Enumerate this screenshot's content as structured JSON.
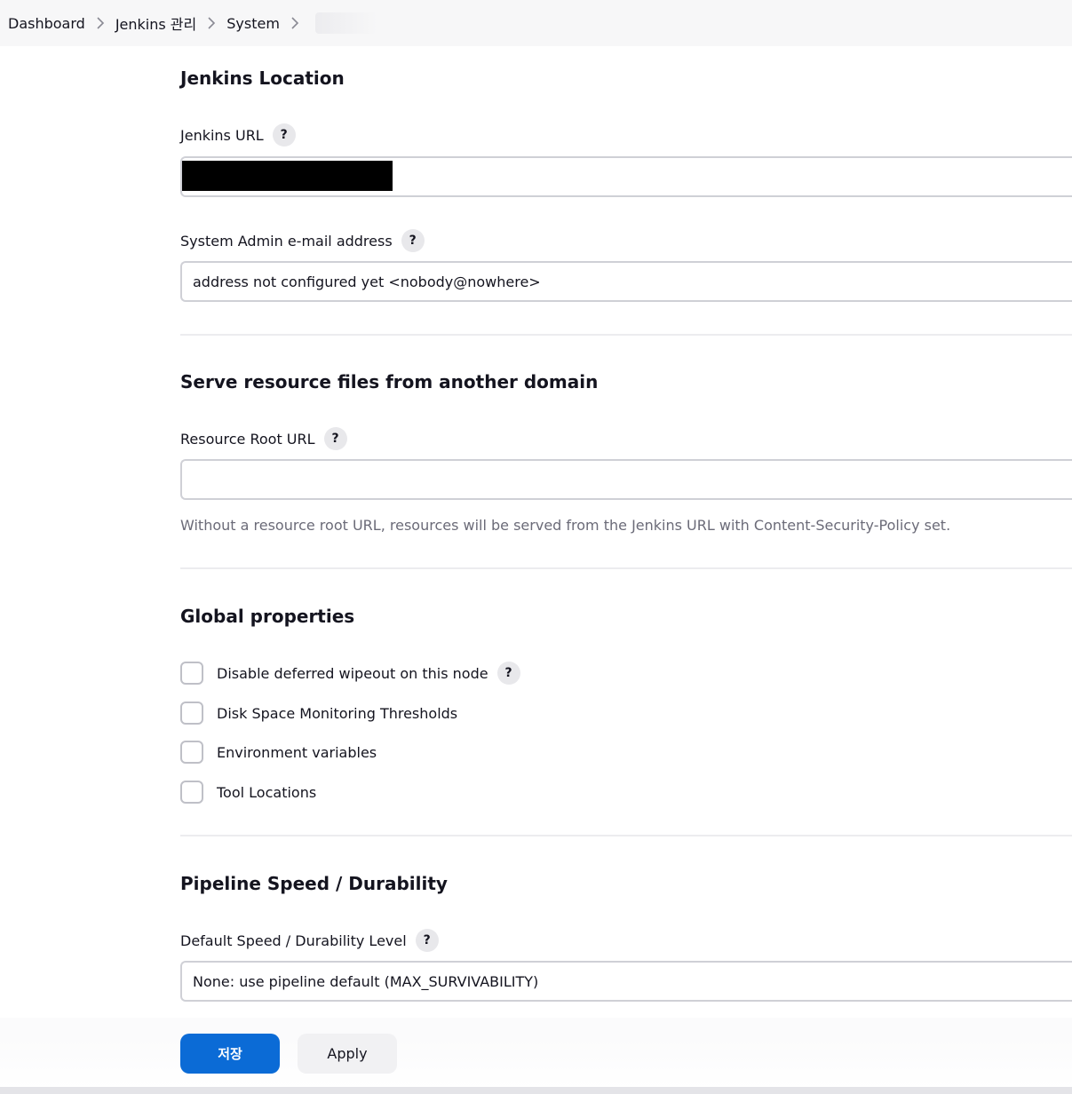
{
  "breadcrumb": {
    "items": [
      "Dashboard",
      "Jenkins 관리",
      "System"
    ]
  },
  "jenkins_location": {
    "title": "Jenkins Location",
    "url_label": "Jenkins URL",
    "url_value": "",
    "email_label": "System Admin e-mail address",
    "email_value": "address not configured yet <nobody@nowhere>"
  },
  "resource_domain": {
    "title": "Serve resource files from another domain",
    "root_url_label": "Resource Root URL",
    "root_url_value": "",
    "hint": "Without a resource root URL, resources will be served from the Jenkins URL with Content-Security-Policy set."
  },
  "global_properties": {
    "title": "Global properties",
    "options": [
      {
        "label": "Disable deferred wipeout on this node",
        "checked": false,
        "has_help": true
      },
      {
        "label": "Disk Space Monitoring Thresholds",
        "checked": false,
        "has_help": false
      },
      {
        "label": "Environment variables",
        "checked": false,
        "has_help": false
      },
      {
        "label": "Tool Locations",
        "checked": false,
        "has_help": false
      }
    ]
  },
  "pipeline_speed": {
    "title": "Pipeline Speed / Durability",
    "level_label": "Default Speed / Durability Level",
    "level_value": "None: use pipeline default (MAX_SURVIVABILITY)"
  },
  "actions": {
    "save_label": "저장",
    "apply_label": "Apply"
  },
  "help_glyph": "?",
  "colors": {
    "primary": "#0b6bd6",
    "breadcrumb_bg": "#f7f7f8",
    "hint_text": "#6b6b78"
  }
}
